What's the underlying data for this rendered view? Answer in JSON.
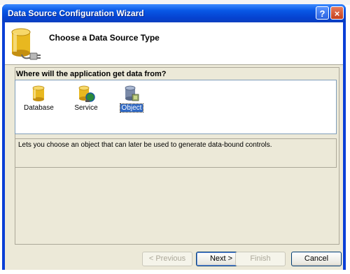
{
  "window": {
    "title": "Data Source Configuration Wizard",
    "help_label": "?",
    "close_label": "×"
  },
  "header": {
    "title": "Choose a Data Source Type",
    "icon": "database-plug-icon"
  },
  "question": "Where will the application get data from?",
  "items": [
    {
      "label": "Database",
      "icon": "database-icon"
    },
    {
      "label": "Service",
      "icon": "service-icon"
    },
    {
      "label": "Object",
      "icon": "object-icon",
      "selected": true
    }
  ],
  "description": "Lets you choose an object that can later be used to generate data-bound controls.",
  "buttons": {
    "previous": "< Previous",
    "next": "Next >",
    "finish": "Finish",
    "cancel": "Cancel"
  },
  "colors": {
    "title_bar": "#0542d0",
    "dialog_bg": "#ece9d8",
    "selection": "#316ac5"
  }
}
